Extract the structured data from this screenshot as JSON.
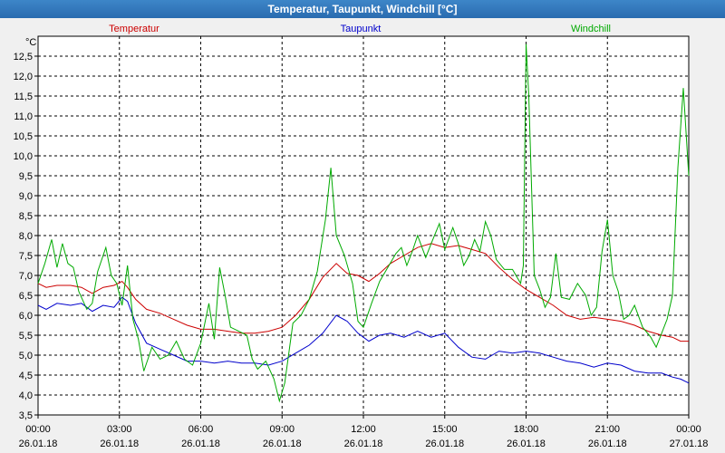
{
  "window": {
    "title": "Temperatur, Taupunkt, Windchill [°C]"
  },
  "chart_data": {
    "type": "line",
    "title": "Temperatur, Taupunkt, Windchill [°C]",
    "ylabel": "°C",
    "ylim": [
      3.5,
      13.0
    ],
    "xlim": [
      0,
      24
    ],
    "grid": true,
    "legend_placement": "top",
    "y_ticks": [
      "3,5",
      "4,0",
      "4,5",
      "5,0",
      "5,5",
      "6,0",
      "6,5",
      "7,0",
      "7,5",
      "8,0",
      "8,5",
      "9,0",
      "9,5",
      "10,0",
      "10,5",
      "11,0",
      "11,5",
      "12,0",
      "12,5"
    ],
    "x_ticks": [
      {
        "time": "00:00",
        "date": "26.01.18"
      },
      {
        "time": "03:00",
        "date": "26.01.18"
      },
      {
        "time": "06:00",
        "date": "26.01.18"
      },
      {
        "time": "09:00",
        "date": "26.01.18"
      },
      {
        "time": "12:00",
        "date": "26.01.18"
      },
      {
        "time": "15:00",
        "date": "26.01.18"
      },
      {
        "time": "18:00",
        "date": "26.01.18"
      },
      {
        "time": "21:00",
        "date": "26.01.18"
      },
      {
        "time": "00:00",
        "date": "27.01.18"
      }
    ],
    "series": [
      {
        "name": "Temperatur",
        "color": "#cc0000",
        "points": [
          [
            0,
            6.8
          ],
          [
            0.3,
            6.7
          ],
          [
            0.7,
            6.75
          ],
          [
            1.2,
            6.75
          ],
          [
            1.6,
            6.7
          ],
          [
            2.0,
            6.55
          ],
          [
            2.4,
            6.7
          ],
          [
            2.8,
            6.75
          ],
          [
            3.1,
            6.85
          ],
          [
            3.3,
            6.7
          ],
          [
            3.6,
            6.4
          ],
          [
            4.0,
            6.15
          ],
          [
            4.5,
            6.05
          ],
          [
            5.0,
            5.9
          ],
          [
            5.5,
            5.75
          ],
          [
            6.0,
            5.65
          ],
          [
            6.5,
            5.65
          ],
          [
            7.0,
            5.6
          ],
          [
            7.5,
            5.55
          ],
          [
            8.0,
            5.55
          ],
          [
            8.5,
            5.6
          ],
          [
            9.0,
            5.7
          ],
          [
            9.5,
            6.0
          ],
          [
            10.0,
            6.4
          ],
          [
            10.5,
            6.95
          ],
          [
            11.0,
            7.3
          ],
          [
            11.4,
            7.05
          ],
          [
            11.8,
            7.0
          ],
          [
            12.2,
            6.85
          ],
          [
            12.6,
            7.05
          ],
          [
            13.0,
            7.3
          ],
          [
            13.5,
            7.5
          ],
          [
            14.0,
            7.7
          ],
          [
            14.5,
            7.8
          ],
          [
            15.0,
            7.7
          ],
          [
            15.5,
            7.75
          ],
          [
            16.0,
            7.65
          ],
          [
            16.5,
            7.55
          ],
          [
            17.0,
            7.2
          ],
          [
            17.5,
            6.9
          ],
          [
            18.0,
            6.65
          ],
          [
            18.5,
            6.45
          ],
          [
            19.0,
            6.25
          ],
          [
            19.5,
            6.0
          ],
          [
            20.0,
            5.9
          ],
          [
            20.5,
            5.95
          ],
          [
            21.0,
            5.9
          ],
          [
            21.5,
            5.85
          ],
          [
            22.0,
            5.75
          ],
          [
            22.5,
            5.6
          ],
          [
            23.0,
            5.5
          ],
          [
            23.4,
            5.45
          ],
          [
            23.7,
            5.35
          ],
          [
            24.0,
            5.35
          ]
        ]
      },
      {
        "name": "Taupunkt",
        "color": "#0000cc",
        "points": [
          [
            0,
            6.25
          ],
          [
            0.3,
            6.15
          ],
          [
            0.7,
            6.3
          ],
          [
            1.2,
            6.25
          ],
          [
            1.6,
            6.3
          ],
          [
            2.0,
            6.1
          ],
          [
            2.4,
            6.25
          ],
          [
            2.8,
            6.2
          ],
          [
            3.1,
            6.45
          ],
          [
            3.3,
            6.35
          ],
          [
            3.6,
            5.8
          ],
          [
            4.0,
            5.3
          ],
          [
            4.5,
            5.15
          ],
          [
            5.0,
            5.0
          ],
          [
            5.5,
            4.85
          ],
          [
            6.0,
            4.85
          ],
          [
            6.5,
            4.8
          ],
          [
            7.0,
            4.85
          ],
          [
            7.5,
            4.8
          ],
          [
            8.0,
            4.8
          ],
          [
            8.5,
            4.75
          ],
          [
            9.0,
            4.85
          ],
          [
            9.5,
            5.05
          ],
          [
            10.0,
            5.25
          ],
          [
            10.5,
            5.55
          ],
          [
            11.0,
            6.0
          ],
          [
            11.4,
            5.85
          ],
          [
            11.8,
            5.55
          ],
          [
            12.2,
            5.35
          ],
          [
            12.6,
            5.5
          ],
          [
            13.0,
            5.55
          ],
          [
            13.5,
            5.45
          ],
          [
            14.0,
            5.6
          ],
          [
            14.5,
            5.45
          ],
          [
            15.0,
            5.55
          ],
          [
            15.5,
            5.2
          ],
          [
            16.0,
            4.95
          ],
          [
            16.5,
            4.9
          ],
          [
            17.0,
            5.1
          ],
          [
            17.5,
            5.05
          ],
          [
            18.0,
            5.1
          ],
          [
            18.5,
            5.05
          ],
          [
            19.0,
            4.95
          ],
          [
            19.5,
            4.85
          ],
          [
            20.0,
            4.8
          ],
          [
            20.5,
            4.7
          ],
          [
            21.0,
            4.8
          ],
          [
            21.5,
            4.75
          ],
          [
            22.0,
            4.6
          ],
          [
            22.5,
            4.55
          ],
          [
            23.0,
            4.55
          ],
          [
            23.4,
            4.45
          ],
          [
            23.7,
            4.4
          ],
          [
            24.0,
            4.3
          ]
        ]
      },
      {
        "name": "Windchill",
        "color": "#00aa00",
        "points": [
          [
            0,
            6.8
          ],
          [
            0.25,
            7.3
          ],
          [
            0.5,
            7.9
          ],
          [
            0.7,
            7.2
          ],
          [
            0.9,
            7.8
          ],
          [
            1.1,
            7.3
          ],
          [
            1.3,
            7.2
          ],
          [
            1.5,
            6.6
          ],
          [
            1.8,
            6.15
          ],
          [
            2.0,
            6.3
          ],
          [
            2.2,
            7.1
          ],
          [
            2.5,
            7.7
          ],
          [
            2.7,
            7.0
          ],
          [
            2.9,
            6.8
          ],
          [
            3.1,
            6.25
          ],
          [
            3.3,
            7.25
          ],
          [
            3.5,
            5.9
          ],
          [
            3.7,
            5.4
          ],
          [
            3.9,
            4.6
          ],
          [
            4.2,
            5.2
          ],
          [
            4.5,
            4.9
          ],
          [
            4.8,
            5.0
          ],
          [
            5.1,
            5.35
          ],
          [
            5.4,
            4.9
          ],
          [
            5.7,
            4.75
          ],
          [
            6.0,
            5.3
          ],
          [
            6.3,
            6.3
          ],
          [
            6.5,
            5.4
          ],
          [
            6.7,
            7.2
          ],
          [
            6.9,
            6.5
          ],
          [
            7.1,
            5.7
          ],
          [
            7.4,
            5.6
          ],
          [
            7.7,
            5.5
          ],
          [
            7.9,
            4.9
          ],
          [
            8.1,
            4.65
          ],
          [
            8.4,
            4.85
          ],
          [
            8.7,
            4.4
          ],
          [
            8.9,
            3.85
          ],
          [
            9.1,
            4.3
          ],
          [
            9.4,
            5.8
          ],
          [
            9.7,
            6.0
          ],
          [
            10.0,
            6.4
          ],
          [
            10.3,
            7.1
          ],
          [
            10.6,
            8.4
          ],
          [
            10.8,
            9.7
          ],
          [
            11.0,
            8.0
          ],
          [
            11.3,
            7.5
          ],
          [
            11.6,
            6.8
          ],
          [
            11.8,
            5.85
          ],
          [
            12.0,
            5.7
          ],
          [
            12.3,
            6.3
          ],
          [
            12.6,
            6.85
          ],
          [
            12.9,
            7.2
          ],
          [
            13.2,
            7.55
          ],
          [
            13.4,
            7.7
          ],
          [
            13.6,
            7.25
          ],
          [
            13.8,
            7.6
          ],
          [
            14.0,
            8.0
          ],
          [
            14.3,
            7.45
          ],
          [
            14.5,
            7.8
          ],
          [
            14.8,
            8.3
          ],
          [
            15.0,
            7.65
          ],
          [
            15.3,
            8.2
          ],
          [
            15.5,
            7.8
          ],
          [
            15.7,
            7.25
          ],
          [
            15.9,
            7.5
          ],
          [
            16.1,
            7.9
          ],
          [
            16.3,
            7.6
          ],
          [
            16.5,
            8.35
          ],
          [
            16.7,
            8.0
          ],
          [
            16.9,
            7.4
          ],
          [
            17.2,
            7.15
          ],
          [
            17.5,
            7.15
          ],
          [
            17.8,
            6.8
          ],
          [
            17.9,
            7.25
          ],
          [
            18.0,
            12.8
          ],
          [
            18.1,
            11.5
          ],
          [
            18.3,
            7.0
          ],
          [
            18.5,
            6.65
          ],
          [
            18.7,
            6.2
          ],
          [
            18.9,
            6.45
          ],
          [
            19.1,
            7.55
          ],
          [
            19.3,
            6.45
          ],
          [
            19.6,
            6.4
          ],
          [
            19.9,
            6.8
          ],
          [
            20.2,
            6.5
          ],
          [
            20.4,
            6.0
          ],
          [
            20.6,
            6.2
          ],
          [
            20.8,
            7.6
          ],
          [
            21.0,
            8.4
          ],
          [
            21.2,
            7.0
          ],
          [
            21.4,
            6.6
          ],
          [
            21.6,
            5.9
          ],
          [
            21.8,
            6.0
          ],
          [
            22.0,
            6.25
          ],
          [
            22.3,
            5.7
          ],
          [
            22.6,
            5.45
          ],
          [
            22.8,
            5.2
          ],
          [
            23.0,
            5.55
          ],
          [
            23.2,
            5.9
          ],
          [
            23.4,
            6.5
          ],
          [
            23.6,
            9.7
          ],
          [
            23.8,
            11.7
          ],
          [
            24.0,
            9.5
          ]
        ]
      }
    ]
  }
}
